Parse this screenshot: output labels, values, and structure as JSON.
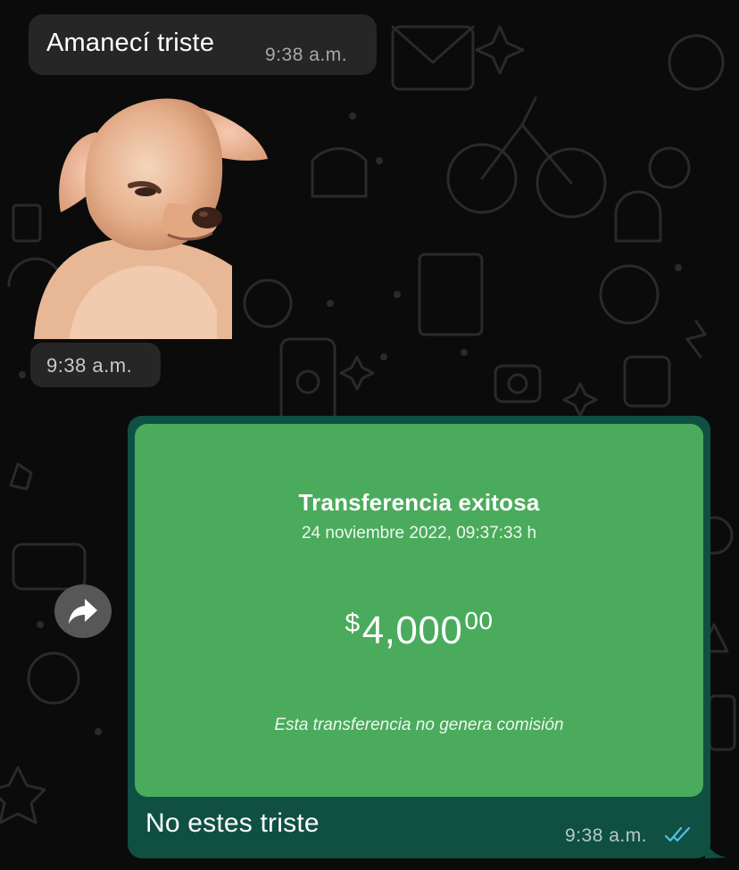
{
  "conversation": {
    "incoming_text": {
      "text": "Amanecí triste",
      "time": "9:38 a.m."
    },
    "incoming_sticker": {
      "subject": "sad-chihuahua-puppy",
      "time": "9:38 a.m."
    },
    "outgoing_image": {
      "receipt": {
        "title": "Transferencia exitosa",
        "date": "24 noviembre 2022, 09:37:33 h",
        "currency": "$",
        "amount": "4,000",
        "cents": "00",
        "note": "Esta transferencia no genera comisión"
      },
      "caption": "No estes triste",
      "time": "9:38 a.m.",
      "status": "read"
    },
    "forward_icon": "forward-arrow-icon"
  },
  "colors": {
    "background": "#0b0b0b",
    "incoming_bubble": "#262626",
    "outgoing_bubble": "#0f5043",
    "receipt_green": "#4aab5c",
    "read_ticks": "#53bdeb"
  }
}
